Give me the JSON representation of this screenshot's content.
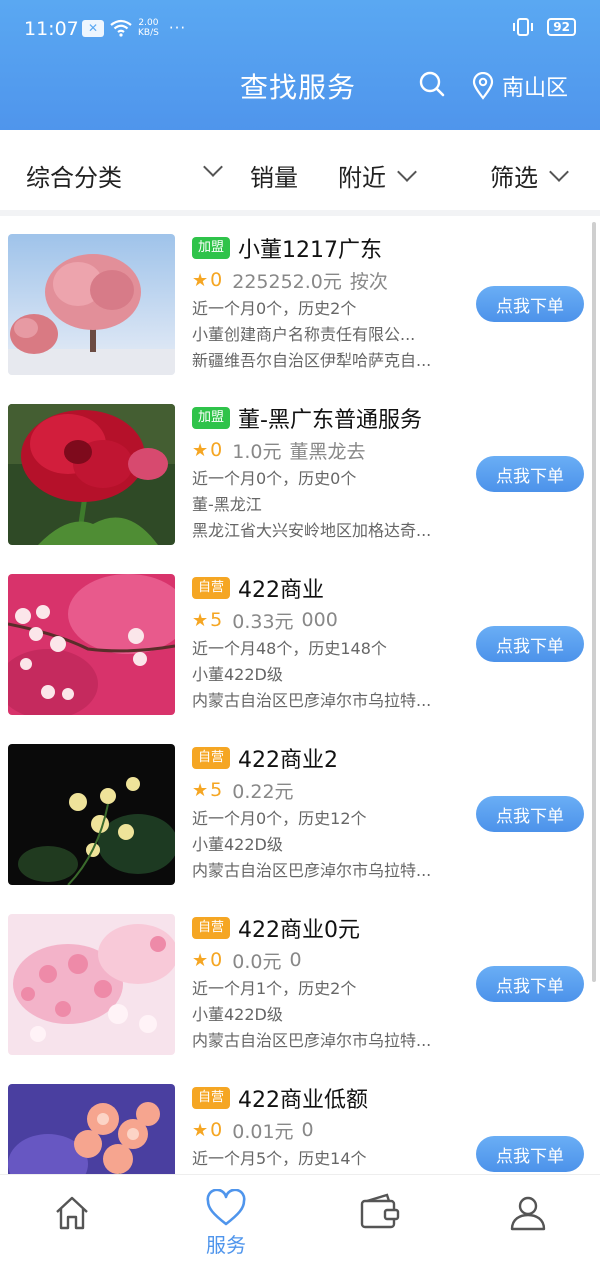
{
  "status_bar": {
    "time": "11:07",
    "net_speed_value": "2.00",
    "net_speed_unit": "KB/S",
    "dots": "···",
    "battery": "92"
  },
  "header": {
    "title": "查找服务",
    "location": "南山区"
  },
  "filters": {
    "category": "综合分类",
    "sales": "销量",
    "nearby": "附近",
    "filter": "筛选"
  },
  "order_button_label": "点我下单",
  "services": [
    {
      "badge": "加盟",
      "badge_type": "join",
      "name": "小董1217广东",
      "rating": "0",
      "price": "225252.0元",
      "unit": "按次",
      "sales": "近一个月0个，历史2个",
      "merchant": "小董创建商户名称责任有限公...",
      "address": "新疆维吾尔自治区伊犁哈萨克自...",
      "image": "pink-tree"
    },
    {
      "badge": "加盟",
      "badge_type": "join",
      "name": "董-黑广东普通服务",
      "rating": "0",
      "price": "1.0元",
      "unit": "董黑龙去",
      "sales": "近一个月0个，历史0个",
      "merchant": "董-黑龙江",
      "address": "黑龙江省大兴安岭地区加格达奇...",
      "image": "red-peony"
    },
    {
      "badge": "自营",
      "badge_type": "self",
      "name": "422商业",
      "rating": "5",
      "price": "0.33元",
      "unit": "000",
      "sales": "近一个月48个，历史148个",
      "merchant": "小董422D级",
      "address": "内蒙古自治区巴彦淖尔市乌拉特...",
      "image": "plum-blossom"
    },
    {
      "badge": "自营",
      "badge_type": "self",
      "name": "422商业2",
      "rating": "5",
      "price": "0.22元",
      "unit": "",
      "sales": "近一个月0个，历史12个",
      "merchant": "小董422D级",
      "address": "内蒙古自治区巴彦淖尔市乌拉特...",
      "image": "yellow-flowers"
    },
    {
      "badge": "自营",
      "badge_type": "self",
      "name": "422商业0元",
      "rating": "0",
      "price": "0.0元",
      "unit": "0",
      "sales": "近一个月1个，历史2个",
      "merchant": "小董422D级",
      "address": "内蒙古自治区巴彦淖尔市乌拉特...",
      "image": "cherry-blossom"
    },
    {
      "badge": "自营",
      "badge_type": "self",
      "name": "422商业低额",
      "rating": "0",
      "price": "0.01元",
      "unit": "0",
      "sales": "近一个月5个，历史14个",
      "merchant": "",
      "address": "",
      "image": "pink-flowers"
    }
  ],
  "tabbar": {
    "active": "服务",
    "service_label": "服务",
    "icons": [
      "home-icon",
      "heart-icon",
      "wallet-icon",
      "user-icon"
    ]
  },
  "colors": {
    "primary": "#4f95ec",
    "join_badge": "#2fc34a",
    "self_badge": "#f5a623",
    "star": "#f5a623"
  }
}
